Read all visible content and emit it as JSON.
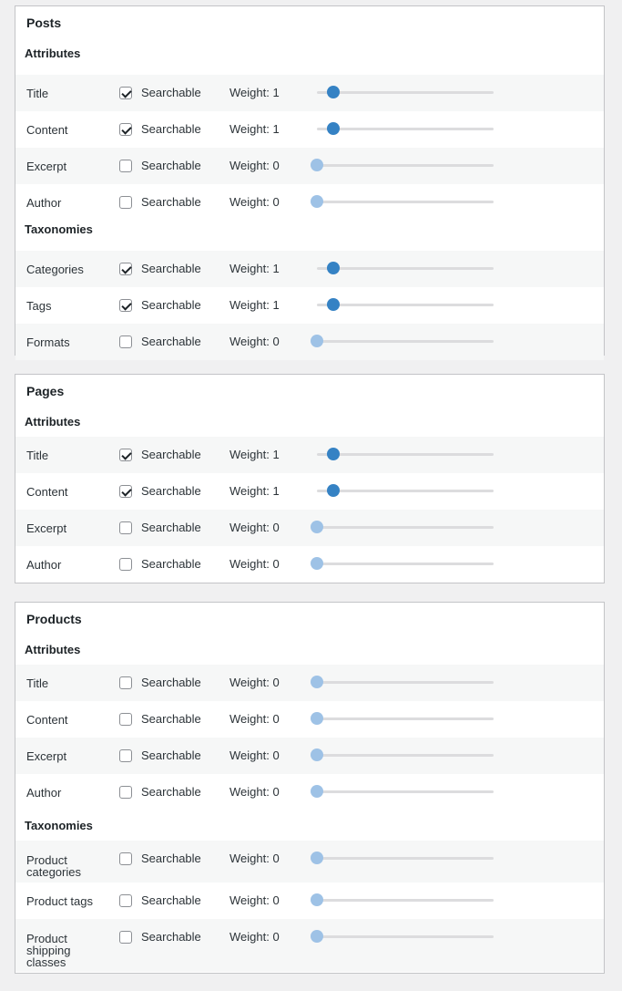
{
  "labels": {
    "searchable": "Searchable",
    "weight_prefix": "Weight: "
  },
  "weight_max": 10,
  "panels": [
    {
      "title": "Posts",
      "sections": [
        {
          "heading": "Attributes",
          "rows": [
            {
              "label": "Title",
              "checked": true,
              "weight": "1"
            },
            {
              "label": "Content",
              "checked": true,
              "weight": "1"
            },
            {
              "label": "Excerpt",
              "checked": false,
              "weight": "0"
            },
            {
              "label": "Author",
              "checked": false,
              "weight": "0"
            }
          ]
        },
        {
          "heading": "Taxonomies",
          "rows": [
            {
              "label": "Categories",
              "checked": true,
              "weight": "1"
            },
            {
              "label": "Tags",
              "checked": true,
              "weight": "1"
            },
            {
              "label": "Formats",
              "checked": false,
              "weight": "0"
            }
          ]
        }
      ]
    },
    {
      "title": "Pages",
      "sections": [
        {
          "heading": "Attributes",
          "rows": [
            {
              "label": "Title",
              "checked": true,
              "weight": "1"
            },
            {
              "label": "Content",
              "checked": true,
              "weight": "1"
            },
            {
              "label": "Excerpt",
              "checked": false,
              "weight": "0"
            },
            {
              "label": "Author",
              "checked": false,
              "weight": "0"
            }
          ]
        }
      ]
    },
    {
      "title": "Products",
      "sections": [
        {
          "heading": "Attributes",
          "rows": [
            {
              "label": "Title",
              "checked": false,
              "weight": "0"
            },
            {
              "label": "Content",
              "checked": false,
              "weight": "0"
            },
            {
              "label": "Excerpt",
              "checked": false,
              "weight": "0"
            },
            {
              "label": "Author",
              "checked": false,
              "weight": "0"
            }
          ]
        },
        {
          "heading": "Taxonomies",
          "rows": [
            {
              "label": "Product categories",
              "checked": false,
              "weight": "0"
            },
            {
              "label": "Product tags",
              "checked": false,
              "weight": "0"
            },
            {
              "label": "Product shipping classes",
              "checked": false,
              "weight": "0"
            }
          ]
        }
      ]
    }
  ]
}
